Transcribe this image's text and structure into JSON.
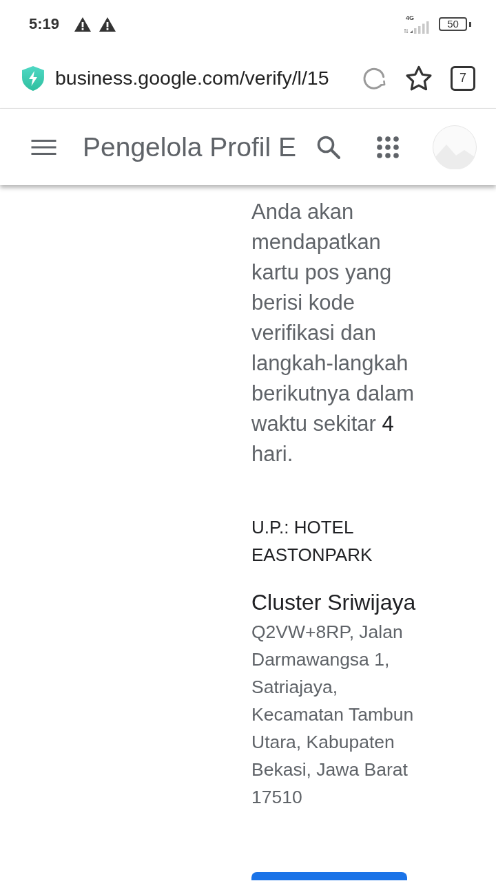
{
  "status_bar": {
    "time": "5:19",
    "network": "4G",
    "battery": "50"
  },
  "browser_bar": {
    "url": "business.google.com/verify/l/15",
    "tab_count": "7"
  },
  "app_bar": {
    "title": "Pengelola Profil E"
  },
  "content": {
    "message": "Anda akan mendapatkan kartu pos yang berisi kode verifikasi dan langkah-langkah berikutnya dalam waktu sekitar **4** hari.",
    "recipient": "U.P.: HOTEL EASTONPARK",
    "business_name": "Cluster Sriwijaya",
    "address": "Q2VW+8RP, Jalan Darmawangsa 1, Satriajaya, Kecamatan Tambun Utara, Kabupaten Bekasi, Jawa Barat 17510"
  }
}
